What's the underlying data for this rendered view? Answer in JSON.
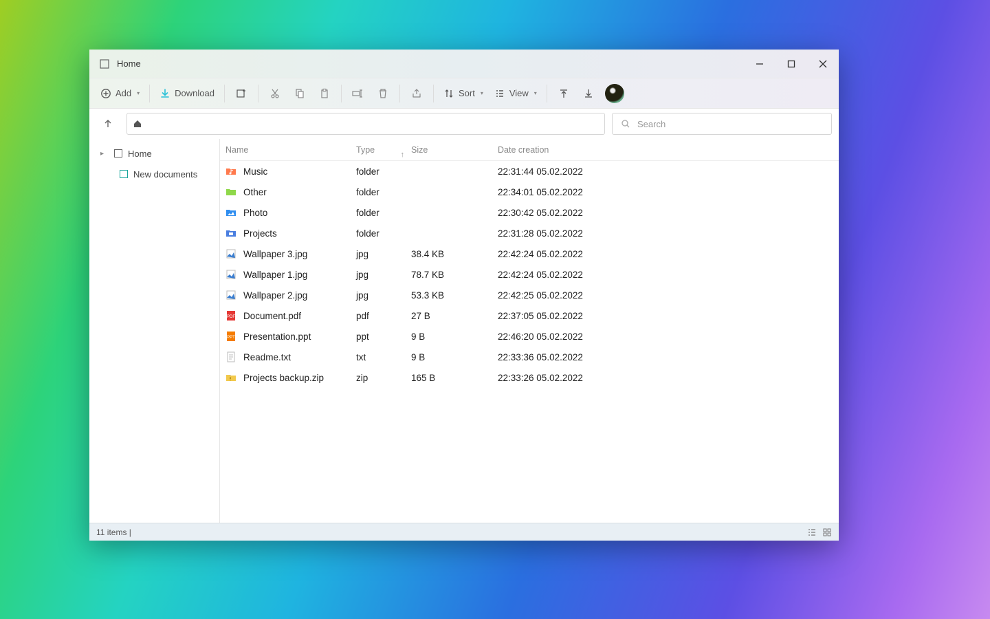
{
  "title": "Home",
  "toolbar": {
    "add_label": "Add",
    "download_label": "Download",
    "sort_label": "Sort",
    "view_label": "View"
  },
  "search": {
    "placeholder": "Search"
  },
  "sidebar": {
    "items": [
      {
        "label": "Home"
      },
      {
        "label": "New documents"
      }
    ]
  },
  "columns": {
    "name": "Name",
    "type": "Type",
    "size": "Size",
    "date": "Date creation"
  },
  "files": [
    {
      "icon": "folder-music",
      "name": "Music",
      "type": "folder",
      "size": "",
      "date": "22:31:44 05.02.2022"
    },
    {
      "icon": "folder-green",
      "name": "Other",
      "type": "folder",
      "size": "",
      "date": "22:34:01 05.02.2022"
    },
    {
      "icon": "folder-photo",
      "name": "Photo",
      "type": "folder",
      "size": "",
      "date": "22:30:42 05.02.2022"
    },
    {
      "icon": "folder-projects",
      "name": "Projects",
      "type": "folder",
      "size": "",
      "date": "22:31:28 05.02.2022"
    },
    {
      "icon": "image",
      "name": "Wallpaper 3.jpg",
      "type": "jpg",
      "size": "38.4 KB",
      "date": "22:42:24 05.02.2022"
    },
    {
      "icon": "image",
      "name": "Wallpaper 1.jpg",
      "type": "jpg",
      "size": "78.7 KB",
      "date": "22:42:24 05.02.2022"
    },
    {
      "icon": "image",
      "name": "Wallpaper 2.jpg",
      "type": "jpg",
      "size": "53.3 KB",
      "date": "22:42:25 05.02.2022"
    },
    {
      "icon": "pdf",
      "name": "Document.pdf",
      "type": "pdf",
      "size": "27 B",
      "date": "22:37:05 05.02.2022"
    },
    {
      "icon": "ppt",
      "name": "Presentation.ppt",
      "type": "ppt",
      "size": "9 B",
      "date": "22:46:20 05.02.2022"
    },
    {
      "icon": "txt",
      "name": "Readme.txt",
      "type": "txt",
      "size": "9 B",
      "date": "22:33:36 05.02.2022"
    },
    {
      "icon": "zip",
      "name": "Projects backup.zip",
      "type": "zip",
      "size": "165 B",
      "date": "22:33:26 05.02.2022"
    }
  ],
  "status": {
    "text": "11 items |"
  }
}
